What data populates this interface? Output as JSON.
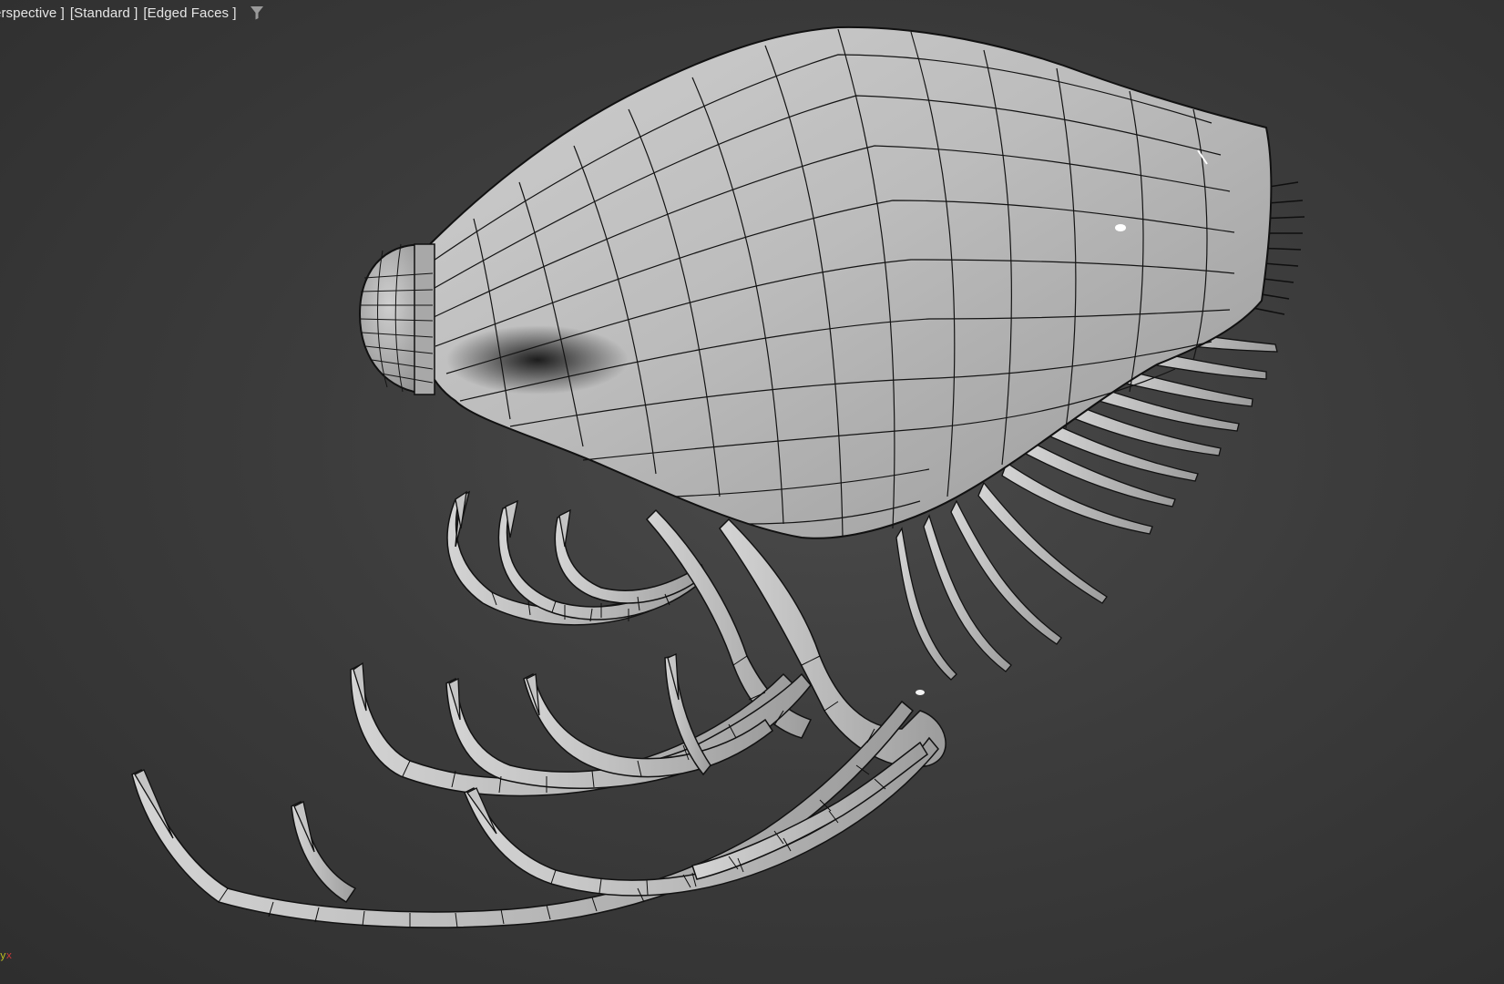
{
  "viewport": {
    "labels": {
      "view": "erspective ]",
      "shading": "[Standard ]",
      "display": "[Edged Faces ]"
    },
    "filter_icon": "funnel-filter-icon",
    "axis": {
      "y": "y",
      "x": "x"
    }
  },
  "colors": {
    "background": "#3c3c3c",
    "mesh_fill": "#bdbdbd",
    "mesh_edges": "#111111",
    "label_text": "#e6e6e6"
  }
}
